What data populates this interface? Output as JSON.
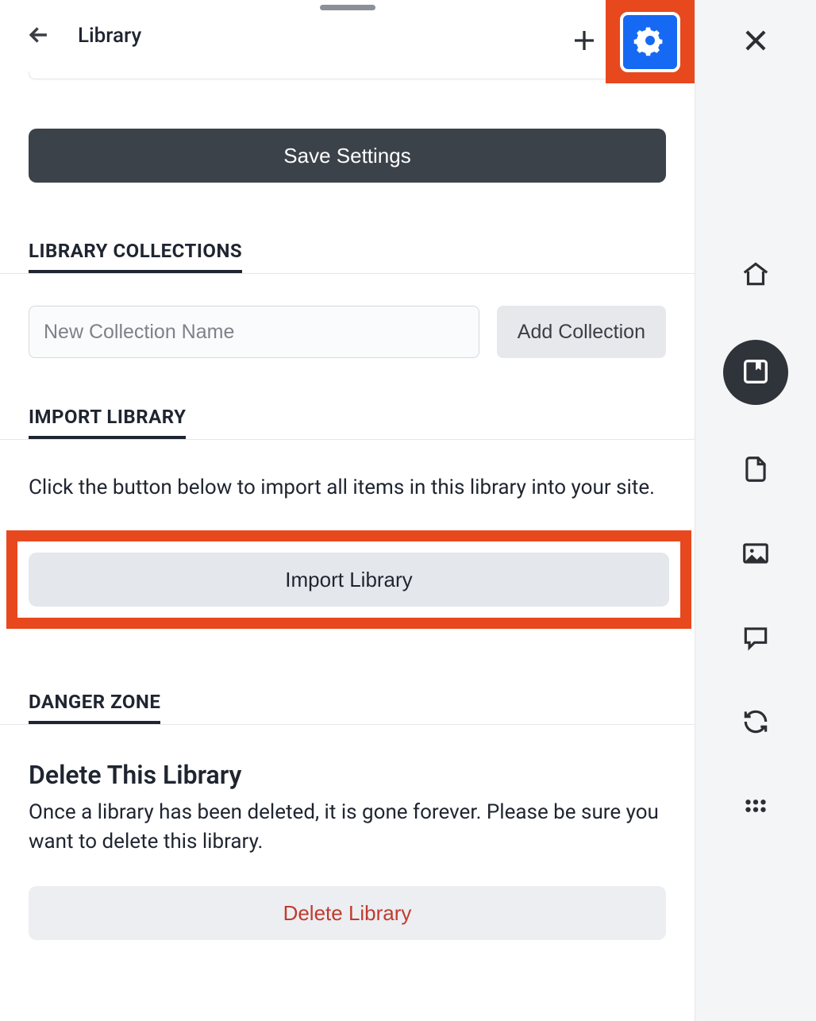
{
  "topbar": {
    "title": "Library"
  },
  "buttons": {
    "save": "Save Settings",
    "add_collection": "Add Collection",
    "import": "Import Library",
    "delete": "Delete Library"
  },
  "sections": {
    "collections_header": "LIBRARY COLLECTIONS",
    "import_header": "IMPORT LIBRARY",
    "danger_header": "DANGER ZONE"
  },
  "collections": {
    "placeholder": "New Collection Name"
  },
  "import": {
    "description": "Click the button below to import all items in this library into your site."
  },
  "danger": {
    "title": "Delete This Library",
    "description": "Once a library has been deleted, it is gone forever. Please be sure you want to delete this library."
  }
}
